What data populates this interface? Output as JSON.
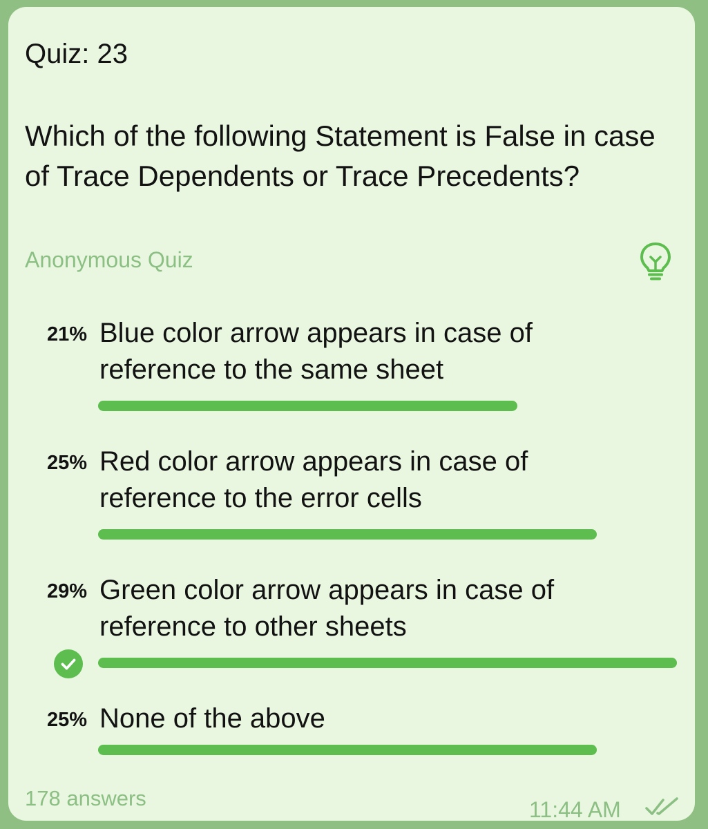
{
  "quiz": {
    "title": "Quiz: 23",
    "question": "Which of the following Statement is False in case of Trace Dependents or Trace Precedents?",
    "type_label": "Anonymous Quiz",
    "hint_icon": "lightbulb-icon"
  },
  "options": [
    {
      "percent_label": "21%",
      "text": "Blue color arrow appears in case of reference to the same sheet",
      "percent": 21,
      "correct": false
    },
    {
      "percent_label": "25%",
      "text": "Red color arrow appears in case of reference to the error cells",
      "percent": 25,
      "correct": false
    },
    {
      "percent_label": "29%",
      "text": "Green color arrow appears in case of reference to other sheets",
      "percent": 29,
      "correct": true
    },
    {
      "percent_label": "25%",
      "text": "None of the above",
      "percent": 25,
      "correct": false
    }
  ],
  "footer": {
    "answers": "178 answers",
    "time": "11:44 AM",
    "status_icon": "double-check-icon"
  },
  "colors": {
    "background": "#8fbf82",
    "bubble": "#e9f7e0",
    "accent": "#5dbd4f",
    "muted_text": "#8cbf83",
    "text": "#121212"
  }
}
